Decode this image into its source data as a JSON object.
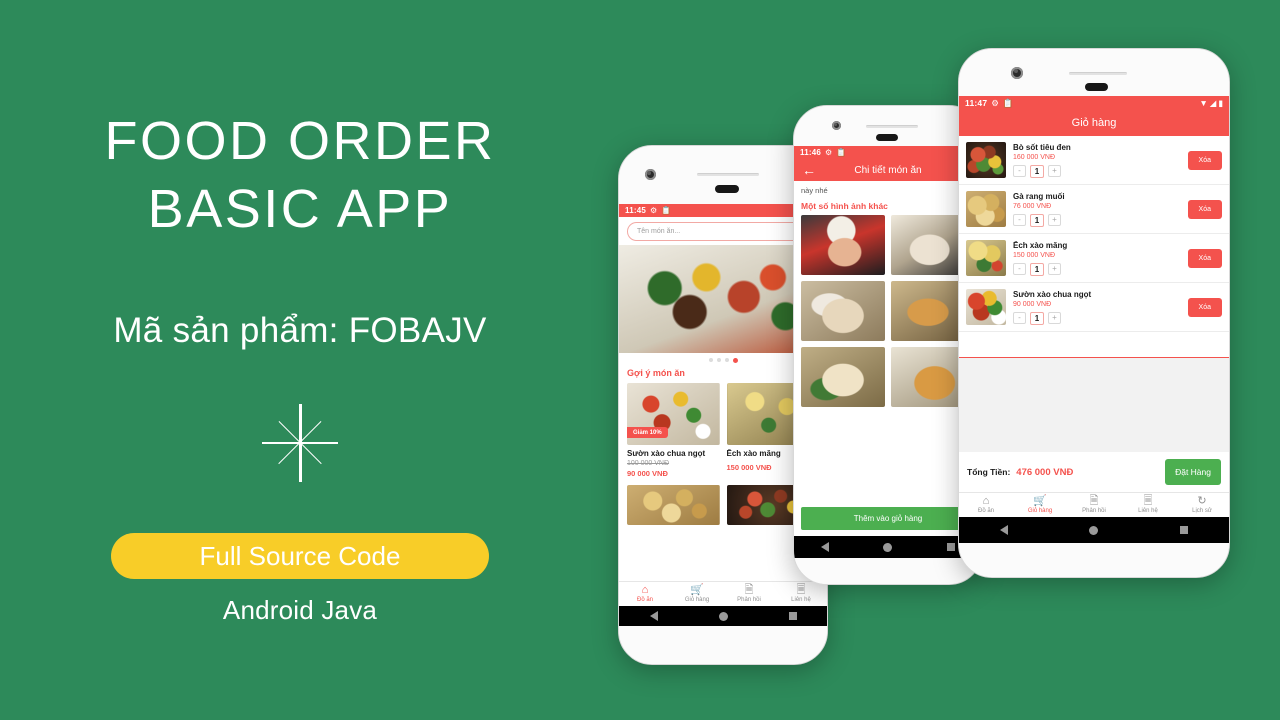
{
  "promo": {
    "title": "FOOD ORDER\nBASIC APP",
    "sku_label": "Mã sản phẩm: FOBAJV",
    "cta_label": "Full Source Code",
    "cta_sub": "Android Java",
    "background_color": "#2d8a5a",
    "cta_color": "#f8cd28"
  },
  "theme": {
    "primary": "#f4524d",
    "accent_green": "#4caf50",
    "green_bg": "#2d8a5a",
    "yellow": "#f8cd28"
  },
  "phone_home": {
    "status": {
      "time": "11:45",
      "icons": [
        "gear-icon",
        "clipboard-icon"
      ]
    },
    "search": {
      "placeholder": "Tên món ăn..."
    },
    "carousel": {
      "dots": 4,
      "active_index": 3
    },
    "section_title": "Gợi ý món ăn",
    "items": [
      {
        "name": "Sườn xào chua ngọt",
        "old_price": "100 000 VNĐ",
        "price": "90 000 VNĐ",
        "badge": "Giảm 10%"
      },
      {
        "name": "Ếch xào măng",
        "old_price": "",
        "price": "150 000 VNĐ",
        "badge": ""
      }
    ],
    "tabs": [
      {
        "label": "Đồ ăn",
        "icon": "home-icon",
        "active": true
      },
      {
        "label": "Giỏ hàng",
        "icon": "cart-icon",
        "active": false
      },
      {
        "label": "Phản hồi",
        "icon": "feedback-icon",
        "active": false
      },
      {
        "label": "Liên hệ",
        "icon": "contact-icon",
        "active": false
      }
    ]
  },
  "phone_detail": {
    "status": {
      "time": "11:46"
    },
    "appbar": {
      "title": "Chi tiết món ăn",
      "back_icon": "arrow-left-icon"
    },
    "body_text": "này nhé",
    "gallery_title": "Một số hình ảnh khác",
    "add_to_cart_label": "Thêm vào giỏ hàng"
  },
  "phone_cart": {
    "status": {
      "time": "11:47"
    },
    "appbar": {
      "title": "Giỏ hàng"
    },
    "items": [
      {
        "name": "Bò sốt tiêu đen",
        "price": "160 000 VNĐ",
        "qty": "1",
        "delete_label": "Xóa",
        "minus": "-",
        "plus": "+"
      },
      {
        "name": "Gà rang muối",
        "price": "76 000 VNĐ",
        "qty": "1",
        "delete_label": "Xóa",
        "minus": "-",
        "plus": "+"
      },
      {
        "name": "Ếch xào măng",
        "price": "150 000 VNĐ",
        "qty": "1",
        "delete_label": "Xóa",
        "minus": "-",
        "plus": "+"
      },
      {
        "name": "Sườn xào chua ngọt",
        "price": "90 000 VNĐ",
        "qty": "1",
        "delete_label": "Xóa",
        "minus": "-",
        "plus": "+"
      }
    ],
    "total_label": "Tổng Tiền:",
    "total_value": "476 000 VNĐ",
    "order_label": "Đặt Hàng",
    "tabs": [
      {
        "label": "Đồ ăn",
        "icon": "home-icon",
        "active": false
      },
      {
        "label": "Giỏ hàng",
        "icon": "cart-icon",
        "active": true
      },
      {
        "label": "Phản hồi",
        "icon": "feedback-icon",
        "active": false
      },
      {
        "label": "Liên hệ",
        "icon": "contact-icon",
        "active": false
      },
      {
        "label": "Lịch sử",
        "icon": "history-icon",
        "active": false
      }
    ]
  }
}
